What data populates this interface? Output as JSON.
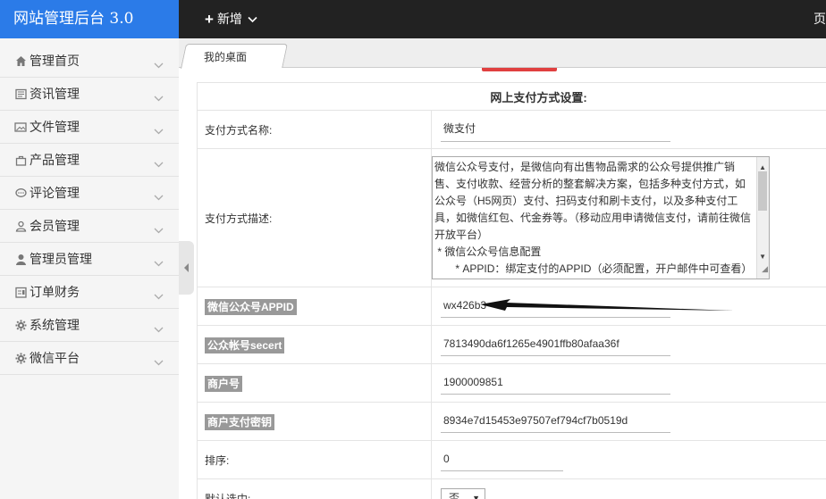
{
  "header": {
    "logo": "网站管理后台 3.0",
    "new_label": "新增",
    "right_text": "页"
  },
  "sidebar": {
    "items": [
      {
        "label": "管理首页",
        "icon": "home-icon"
      },
      {
        "label": "资讯管理",
        "icon": "news-icon"
      },
      {
        "label": "文件管理",
        "icon": "image-icon"
      },
      {
        "label": "产品管理",
        "icon": "bag-icon"
      },
      {
        "label": "评论管理",
        "icon": "comment-icon"
      },
      {
        "label": "会员管理",
        "icon": "user-icon"
      },
      {
        "label": "管理员管理",
        "icon": "admin-icon"
      },
      {
        "label": "订单财务",
        "icon": "order-icon"
      },
      {
        "label": "系统管理",
        "icon": "gear-icon"
      },
      {
        "label": "微信平台",
        "icon": "gear-icon"
      }
    ]
  },
  "tabs": [
    {
      "label": "我的桌面"
    }
  ],
  "form": {
    "section_title": "网上支付方式设置:",
    "name_label": "支付方式名称:",
    "name_value": "微支付",
    "desc_label": "支付方式描述:",
    "desc_value": "微信公众号支付，是微信向有出售物品需求的公众号提供推广销售、支付收款、经营分析的整套解决方案，包括多种支付方式，如公众号（H5网页）支付、扫码支付和刷卡支付，以及多种支付工具，如微信红包、代金券等。（移动应用申请微信支付，请前往微信开放平台）\n * 微信公众号信息配置\n       * APPID：绑定支付的APPID（必须配置，开户邮件中可查看）",
    "appid_label": "微信公众号APPID",
    "appid_value": "wx426b3",
    "secret_label": "公众帐号secert",
    "secret_value": "7813490da6f1265e4901ffb80afaa36f",
    "mch_label": "商户号",
    "mch_value": "1900009851",
    "key_label": "商户支付密钥",
    "key_value": "8934e7d15453e97507ef794cf7b0519d",
    "sort_label": "排序:",
    "sort_value": "0",
    "default_label": "默认选中:",
    "default_value": "否"
  }
}
